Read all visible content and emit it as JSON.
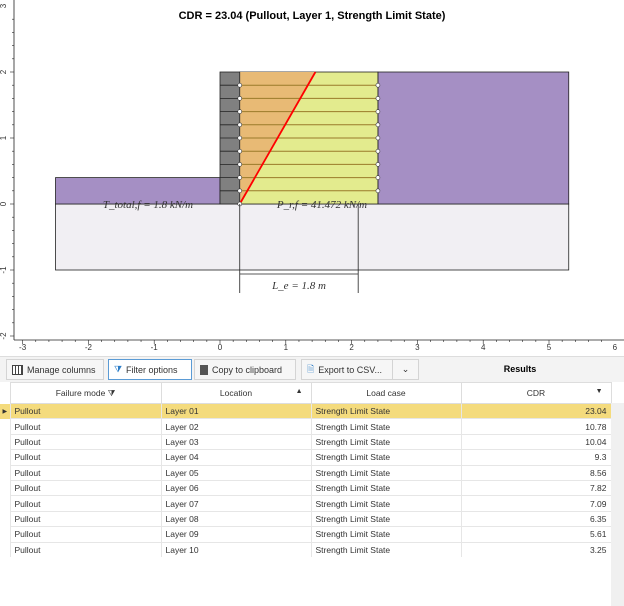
{
  "plot": {
    "title": "CDR = 23.04 (Pullout, Layer 1, Strength Limit State)",
    "x_ticks": [
      "-3",
      "-2",
      "-1",
      "0",
      "1",
      "2",
      "3",
      "4",
      "5",
      "6"
    ],
    "y_ticks": [
      "3",
      "2",
      "1",
      "0",
      "-1",
      "-2"
    ],
    "labels": {
      "t_total": "T_total,f = 1.8 kN/m",
      "p_rf": "P_r,f = 41.472 kN/m",
      "le": "L_e = 1.8 m"
    },
    "colors": {
      "retained_soil": "#a58fc4",
      "foundation": "#f1eff3",
      "facing": "#808080",
      "active_zone": "#e8ba75",
      "resistant_zone": "#e3eb8e",
      "failure_line": "#ff0000"
    }
  },
  "toolbar": {
    "manage_columns": "Manage columns",
    "filter_options": "Filter options",
    "copy": "Copy to clipboard",
    "export": "Export to CSV...",
    "results": "Results"
  },
  "table": {
    "headers": [
      "Failure mode",
      "Location",
      "Load case",
      "CDR"
    ],
    "rows": [
      [
        "Pullout",
        "Layer 01",
        "Strength Limit State",
        "23.04"
      ],
      [
        "Pullout",
        "Layer 02",
        "Strength Limit State",
        "10.78"
      ],
      [
        "Pullout",
        "Layer 03",
        "Strength Limit State",
        "10.04"
      ],
      [
        "Pullout",
        "Layer 04",
        "Strength Limit State",
        "9.3"
      ],
      [
        "Pullout",
        "Layer 05",
        "Strength Limit State",
        "8.56"
      ],
      [
        "Pullout",
        "Layer 06",
        "Strength Limit State",
        "7.82"
      ],
      [
        "Pullout",
        "Layer 07",
        "Strength Limit State",
        "7.09"
      ],
      [
        "Pullout",
        "Layer 08",
        "Strength Limit State",
        "6.35"
      ],
      [
        "Pullout",
        "Layer 09",
        "Strength Limit State",
        "5.61"
      ],
      [
        "Pullout",
        "Layer 10",
        "Strength Limit State",
        "3.25"
      ]
    ]
  }
}
